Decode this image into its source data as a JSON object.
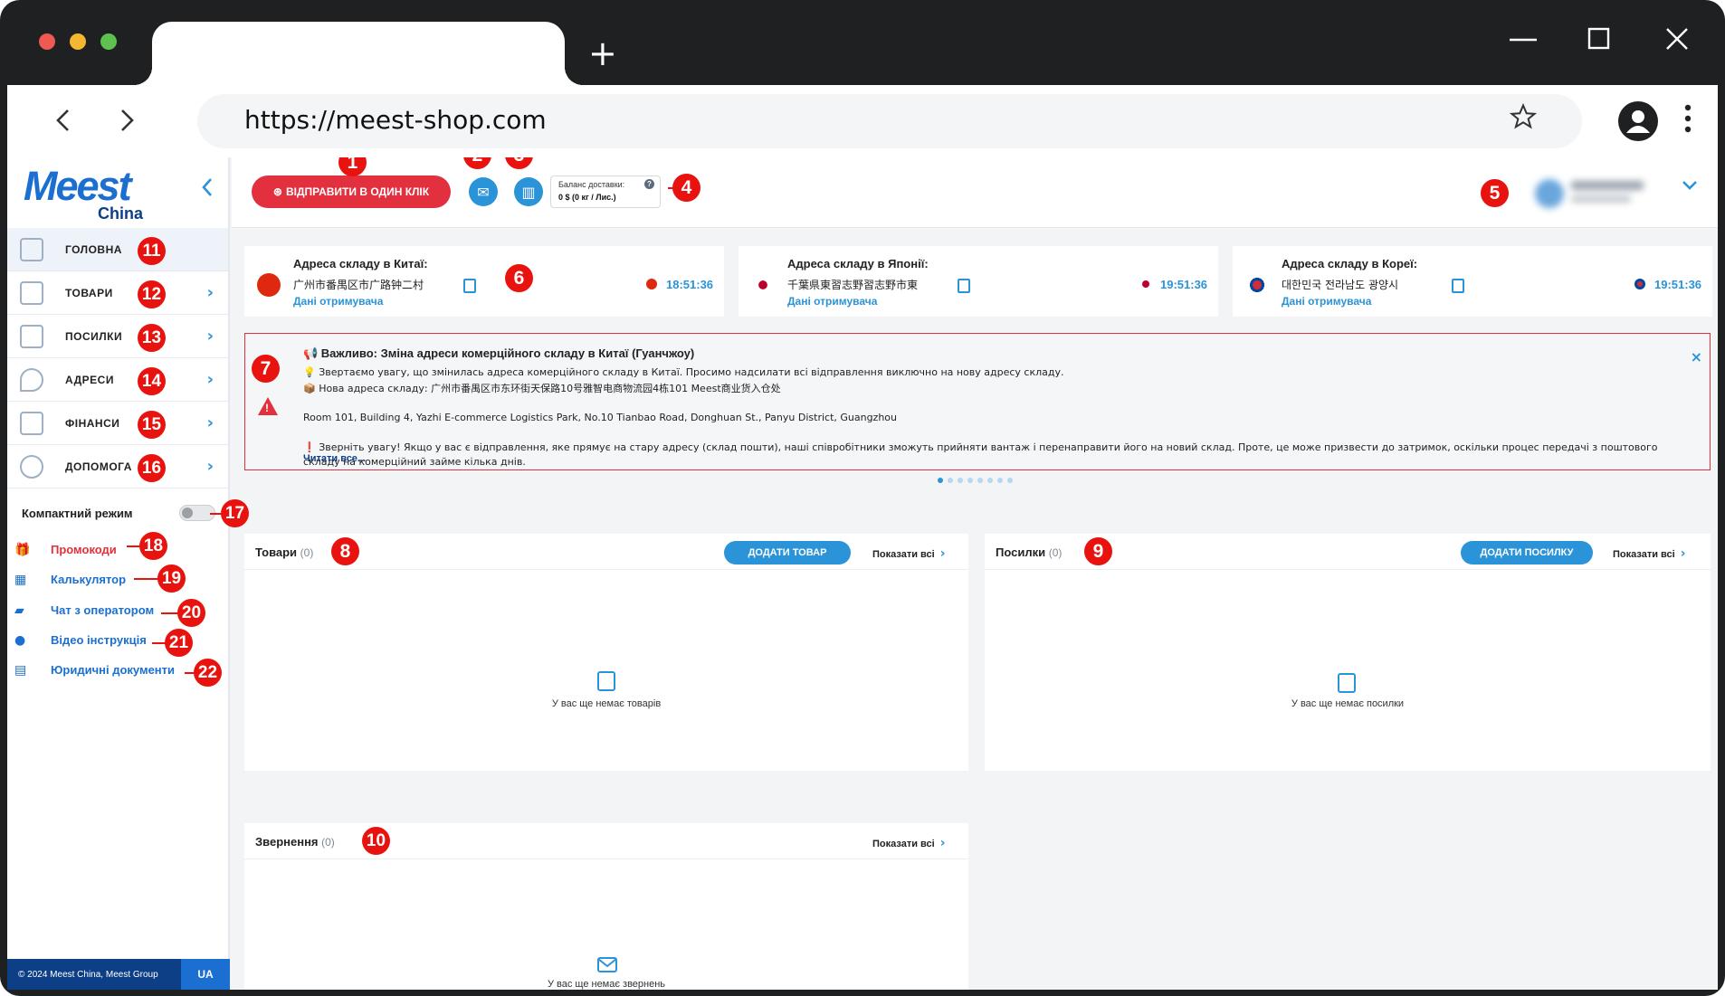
{
  "browser": {
    "url": "https://meest-shop.com",
    "new_tab": "+",
    "nav_back": "‹",
    "nav_forward": "›"
  },
  "brand": {
    "logo": "Meest",
    "logo_sub": "China"
  },
  "topbar": {
    "send_button": "ВІДПРАВИТИ В ОДИН КЛІК",
    "balance_title": "Баланс доставки:",
    "balance_value": "0 $ (0 кг / Лис.)",
    "balance_help": "?"
  },
  "sidebar": {
    "menu": [
      {
        "label": "ГОЛОВНА"
      },
      {
        "label": "ТОВАРИ"
      },
      {
        "label": "ПОСИЛКИ"
      },
      {
        "label": "АДРЕСИ"
      },
      {
        "label": "ФІНАНСИ"
      },
      {
        "label": "ДОПОМОГА"
      }
    ],
    "compact_mode": "Компактний режим",
    "links": [
      {
        "label": "Промокоди",
        "color": "#e2303f"
      },
      {
        "label": "Калькулятор",
        "color": "#1a6fd0"
      },
      {
        "label": "Чат з оператором",
        "color": "#1a6fd0"
      },
      {
        "label": "Відео інструкція",
        "color": "#1a6fd0"
      },
      {
        "label": "Юридичні документи",
        "color": "#1a6fd0"
      }
    ],
    "footer": {
      "copyright": "© 2024 Meest China, Meest Group",
      "lang": "UA"
    }
  },
  "warehouses": [
    {
      "title": "Адреса складу в Китаї:",
      "address": "广州市番禺区市广路钟二村",
      "recipient": "Дані отримувача",
      "time": "18:51:36",
      "flag_color": "#de2910"
    },
    {
      "title": "Адреса складу в Японії:",
      "address": "千葉県東習志野習志野市東",
      "recipient": "Дані отримувача",
      "time": "19:51:36",
      "flag_color": "#bc002d"
    },
    {
      "title": "Адреса складу в Кореї:",
      "address": "대한민국 전라남도 광양시",
      "recipient": "Дані отримувача",
      "time": "19:51:36",
      "flag_color": "#0047a0"
    }
  ],
  "notice": {
    "title": "📢 Важливо: Зміна адреси комерційного складу в Китаї (Гуанчжоу)",
    "line1": "💡 Звертаємо увагу, що змінилась адреса комерційного складу в Китаї. Просимо надсилати всі відправлення виключно на нову адресу складу.",
    "line2": "📦 Нова адреса складу: 广州市番禺区市东环街天保路10号雅智电商物流园4栋101 Meest商业货入仓处",
    "line3": "Room 101, Building 4, Yazhi E-commerce Logistics Park, No.10 Tianbao Road, Donghuan St., Panyu District, Guangzhou",
    "line4": "❗ Зверніть увагу! Якщо у вас є відправлення, яке прямує на стару адресу (склад пошти), наші співробітники зможуть прийняти вантаж і перенаправити його на новий склад. Проте, це може призвести до затримок, оскільки процес передачі з поштового складу на комерційний займе кілька днів.",
    "read_more": "Читати все...",
    "close": "×"
  },
  "panels": {
    "goods": {
      "title": "Товари",
      "count": "(0)",
      "add": "ДОДАТИ ТОВАР",
      "show_all": "Показати всі",
      "empty": "У вас ще немає товарів"
    },
    "parcels": {
      "title": "Посилки",
      "count": "(0)",
      "add": "ДОДАТИ ПОСИЛКУ",
      "show_all": "Показати всі",
      "empty": "У вас ще немає посилки"
    },
    "appeals": {
      "title": "Звернення",
      "count": "(0)",
      "show_all": "Показати всі",
      "empty": "У вас ще немає звернень"
    }
  },
  "badges": [
    "1",
    "2",
    "3",
    "4",
    "5",
    "6",
    "7",
    "8",
    "9",
    "10",
    "11",
    "12",
    "13",
    "14",
    "15",
    "16",
    "17",
    "18",
    "19",
    "20",
    "21",
    "22"
  ],
  "colors": {
    "accent": "#2b93d8",
    "brand": "#1a6fd0",
    "badge": "#e8130f",
    "danger": "#e2303f"
  }
}
